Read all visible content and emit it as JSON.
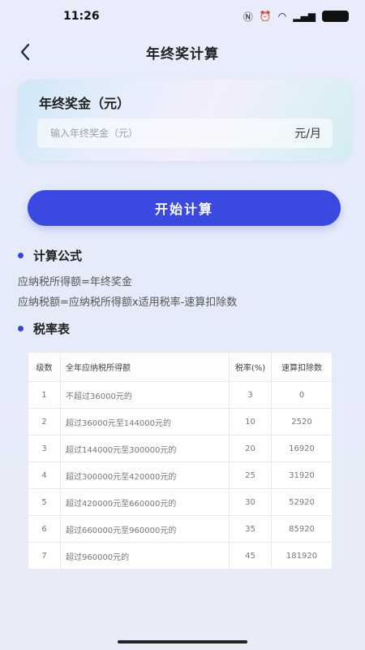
{
  "status_bar": {
    "time": "11:26",
    "icons": [
      "nfc-icon",
      "alarm-icon",
      "wifi-icon",
      "5g-signal-icon"
    ],
    "battery": "100"
  },
  "nav": {
    "back_icon": "chevron-left-icon",
    "title": "年终奖计算"
  },
  "input_card": {
    "title": "年终奖金（元）",
    "placeholder": "输入年终奖金（元）",
    "value": "",
    "unit": "元/月"
  },
  "calc_button": {
    "label": "开始计算",
    "color": "#3a49e0"
  },
  "formula_section": {
    "title": "计算公式",
    "lines": [
      "应纳税所得额=年终奖金",
      "应纳税额=应纳税所得额x适用税率-速算扣除数"
    ]
  },
  "rate_section": {
    "title": "税率表"
  },
  "rate_table": {
    "headers": [
      "级数",
      "全年应纳税所得额",
      "税率(%)",
      "速算扣除数"
    ],
    "rows": [
      [
        "1",
        "不超过36000元的",
        "3",
        "0"
      ],
      [
        "2",
        "超过36000元至144000元的",
        "10",
        "2520"
      ],
      [
        "3",
        "超过144000元至300000元的",
        "20",
        "16920"
      ],
      [
        "4",
        "超过300000元至420000元的",
        "25",
        "31920"
      ],
      [
        "5",
        "超过420000元至660000元的",
        "30",
        "52920"
      ],
      [
        "6",
        "超过660000元至960000元的",
        "35",
        "85920"
      ],
      [
        "7",
        "超过960000元的",
        "45",
        "181920"
      ]
    ]
  }
}
